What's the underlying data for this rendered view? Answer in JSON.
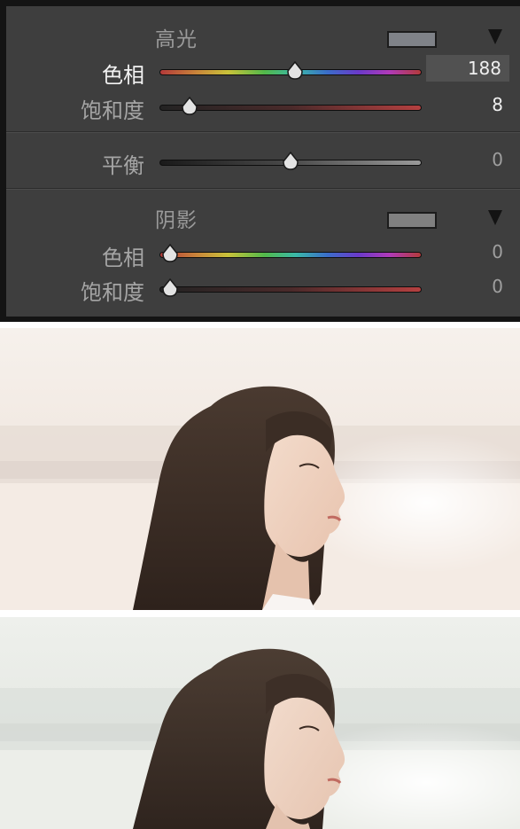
{
  "split_toning": {
    "highlights": {
      "title": "高光",
      "swatch_color": "#7f8288",
      "hue": {
        "label": "色相",
        "value": "188",
        "fraction": 0.52
      },
      "saturation": {
        "label": "饱和度",
        "value": "8",
        "fraction": 0.08
      }
    },
    "balance": {
      "label": "平衡",
      "value": "0",
      "fraction": 0.5
    },
    "shadows": {
      "title": "阴影",
      "swatch_color": "#808080",
      "hue": {
        "label": "色相",
        "value": "0",
        "fraction": 0.0
      },
      "saturation": {
        "label": "饱和度",
        "value": "0",
        "fraction": 0.0
      }
    },
    "icons": [
      "collapse-triangle-icon",
      "slider-thumb-icon"
    ]
  },
  "photos": [
    {
      "name": "before-photo",
      "tone": "warm"
    },
    {
      "name": "after-photo",
      "tone": "cool"
    }
  ],
  "colors": {
    "panel_bg": "#3e3e3e",
    "panel_border": "#141414",
    "value_box": "#515151"
  }
}
